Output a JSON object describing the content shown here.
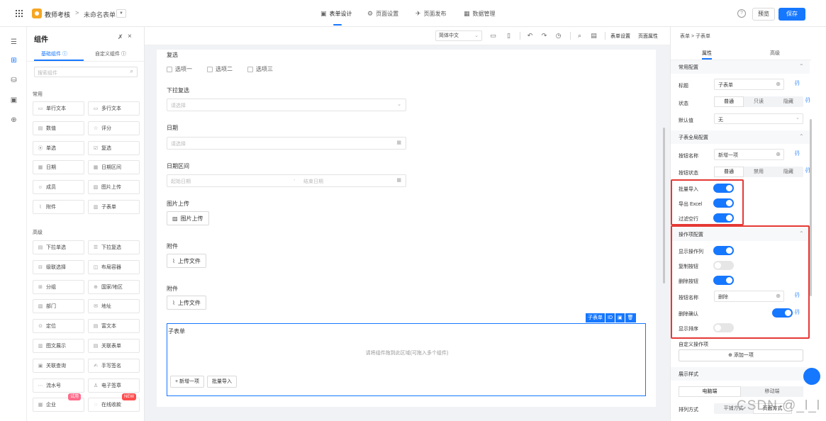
{
  "header": {
    "app_name": "教师考核",
    "crumb_sep": ">",
    "form_name": "未命名表单",
    "tabs": [
      {
        "icon": "▣",
        "label": "表单设计"
      },
      {
        "icon": "⚙",
        "label": "页面设置"
      },
      {
        "icon": "✈",
        "label": "页面发布"
      },
      {
        "icon": "▦",
        "label": "数据管理"
      }
    ],
    "preview_label": "预览",
    "save_label": "保存"
  },
  "widget_panel": {
    "title": "组件",
    "tab_basic": "基础组件 ⓘ",
    "tab_custom": "自定义组件 ⓘ",
    "search_placeholder": "搜索组件",
    "cat_common": "常用",
    "cat_advanced": "高级",
    "common": [
      {
        "icon": "▭",
        "label": "单行文本"
      },
      {
        "icon": "▭",
        "label": "多行文本"
      },
      {
        "icon": "▤",
        "label": "数值"
      },
      {
        "icon": "☆",
        "label": "评分"
      },
      {
        "icon": "⦿",
        "label": "单选"
      },
      {
        "icon": "☑",
        "label": "复选"
      },
      {
        "icon": "▦",
        "label": "日期"
      },
      {
        "icon": "▦",
        "label": "日期区间"
      },
      {
        "icon": "☺",
        "label": "成员"
      },
      {
        "icon": "▨",
        "label": "图片上传"
      },
      {
        "icon": "⌇",
        "label": "附件"
      },
      {
        "icon": "▥",
        "label": "子表单"
      }
    ],
    "advanced": [
      {
        "icon": "▤",
        "label": "下拉单选"
      },
      {
        "icon": "☰",
        "label": "下拉复选"
      },
      {
        "icon": "⊟",
        "label": "级联选择"
      },
      {
        "icon": "◫",
        "label": "布局容器"
      },
      {
        "icon": "⊞",
        "label": "分组"
      },
      {
        "icon": "⊕",
        "label": "国家/地区"
      },
      {
        "icon": "▧",
        "label": "部门"
      },
      {
        "icon": "✉",
        "label": "地址"
      },
      {
        "icon": "⊙",
        "label": "定位"
      },
      {
        "icon": "▤",
        "label": "富文本"
      },
      {
        "icon": "▥",
        "label": "图文展示"
      },
      {
        "icon": "▤",
        "label": "关联表单"
      },
      {
        "icon": "▣",
        "label": "关联查询"
      },
      {
        "icon": "✍",
        "label": "手写签名"
      },
      {
        "icon": "⋯",
        "label": "流水号"
      },
      {
        "icon": "♙",
        "label": "电子签章"
      },
      {
        "icon": "▦",
        "label": "企业",
        "badge": "试用"
      },
      {
        "icon": "◌",
        "label": "在线收款",
        "badge": "NEW"
      }
    ]
  },
  "canvas_toolbar": {
    "lang": "简体中文",
    "form_settings": "表单设置",
    "page_props": "页面属性"
  },
  "form": {
    "checkbox_label": "复选",
    "checkbox_options": [
      "选项一",
      "选项二",
      "选项三"
    ],
    "dropdown_multi_label": "下拉复选",
    "dropdown_placeholder": "请选择",
    "date_label": "日期",
    "date_placeholder": "请选择",
    "date_range_label": "日期区间",
    "date_range_start": "起始日期",
    "date_range_sep": "-",
    "date_range_end": "结束日期",
    "image_upload_label": "图片上传",
    "image_upload_button": "图片上传",
    "attachment1_label": "附件",
    "attachment1_button": "上传文件",
    "attachment2_label": "附件",
    "attachment2_button": "上传文件",
    "subform_badge": "子表单",
    "subform_title": "子表单",
    "subform_drop_hint": "请将组件拖到此区域(可拖入多个组件)",
    "subform_add_button": "+ 新增一项",
    "subform_import_button": "批量导入"
  },
  "props": {
    "crumb": "表单 > 子表单",
    "tab_props": "属性",
    "tab_advanced": "高级",
    "sec_common": "常用配置",
    "title_label": "标题",
    "title_value": "子表单",
    "fx": "{/}",
    "status_label": "状态",
    "status_options": [
      "普通",
      "只读",
      "隐藏"
    ],
    "default_label": "默认值",
    "default_value": "无",
    "sec_global": "子表全局配置",
    "button_name_label": "按钮名称",
    "button_name_value": "新增一项",
    "button_status_label": "按钮状态",
    "button_status_options": [
      "普通",
      "禁用",
      "隐藏"
    ],
    "batch_import_label": "批量导入",
    "export_excel_label": "导出 Excel",
    "filter_empty_label": "过滤空行",
    "sec_operations": "操作项配置",
    "show_ops_label": "显示操作列",
    "copy_button_label": "复制按钮",
    "delete_button_label": "删除按钮",
    "ops_button_name_label": "按钮名称",
    "ops_button_name_value": "删除",
    "delete_confirm_label": "删除确认",
    "show_order_label": "显示排序",
    "custom_ops_label": "自定义操作项",
    "add_item_button": "⊕ 添加一项",
    "sec_display": "展示样式",
    "display_options": [
      "电脑端",
      "移动端"
    ],
    "arrange_label": "排列方式",
    "arrange_options": [
      "平铺方式",
      "页面方式"
    ],
    "toggles": {
      "batch_import": true,
      "export_excel": true,
      "filter_empty": true,
      "show_ops": true,
      "copy_button": false,
      "delete_button": true,
      "delete_confirm": true,
      "show_order": false
    }
  },
  "watermark": "CSDN @_l_l",
  "colors": {
    "accent": "#1677ff",
    "highlight": "#e53935",
    "logo": "#f6a623"
  }
}
